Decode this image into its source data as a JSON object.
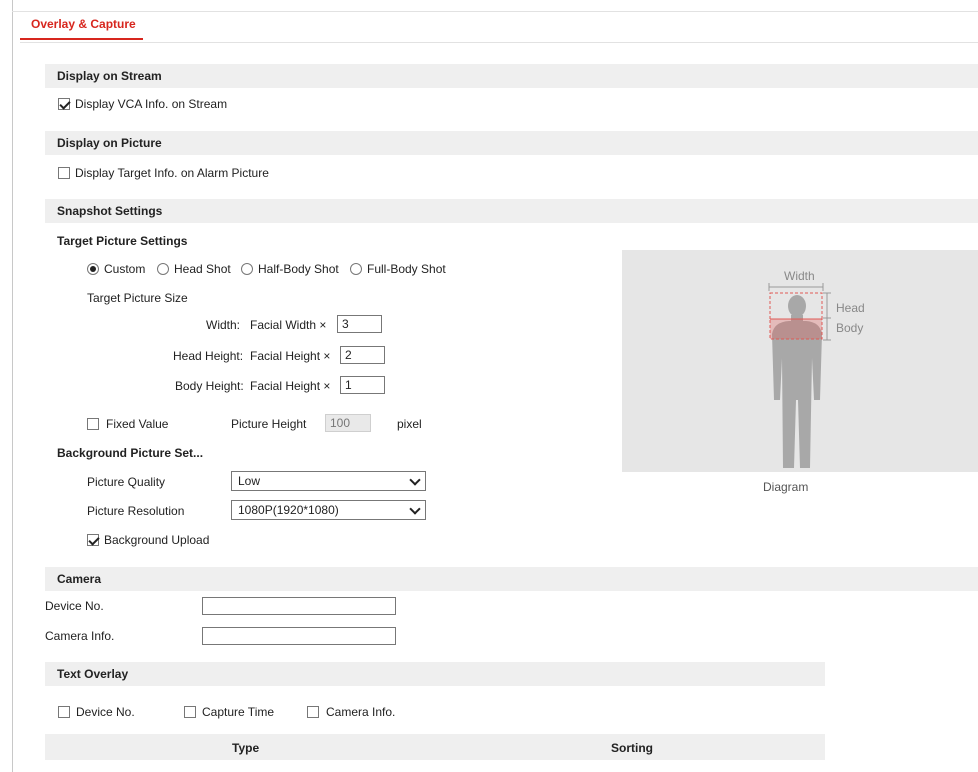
{
  "tabs": [
    {
      "label": "Overlay & Capture"
    }
  ],
  "display_on_stream": {
    "title": "Display on Stream",
    "vca_checkbox": {
      "label": "Display VCA Info. on Stream",
      "checked": true
    }
  },
  "display_on_picture": {
    "title": "Display on Picture",
    "target_checkbox": {
      "label": "Display Target Info. on Alarm Picture",
      "checked": false
    }
  },
  "snapshot": {
    "title": "Snapshot Settings",
    "target_picture": {
      "title": "Target Picture Settings",
      "modes": [
        {
          "label": "Custom",
          "selected": true
        },
        {
          "label": "Head Shot",
          "selected": false
        },
        {
          "label": "Half-Body Shot",
          "selected": false
        },
        {
          "label": "Full-Body Shot",
          "selected": false
        }
      ],
      "size_title": "Target Picture Size",
      "width": {
        "label": "Width:",
        "expr": "Facial Width ×",
        "value": "3"
      },
      "head_height": {
        "label": "Head Height:",
        "expr": "Facial Height ×",
        "value": "2"
      },
      "body_height": {
        "label": "Body Height:",
        "expr": "Facial Height ×",
        "value": "1"
      },
      "fixed_value": {
        "label": "Fixed Value",
        "checked": false
      },
      "picture_height": {
        "label": "Picture Height",
        "value": "100",
        "unit": "pixel"
      }
    },
    "background": {
      "title": "Background Picture Set...",
      "quality": {
        "label": "Picture Quality",
        "value": "Low"
      },
      "resolution": {
        "label": "Picture Resolution",
        "value": "1080P(1920*1080)"
      },
      "upload": {
        "label": "Background Upload",
        "checked": true
      }
    },
    "diagram": {
      "caption": "Diagram",
      "width_label": "Width",
      "head_label": "Head",
      "body_label": "Body"
    }
  },
  "camera": {
    "title": "Camera",
    "device_no": {
      "label": "Device No.",
      "value": ""
    },
    "camera_info": {
      "label": "Camera Info.",
      "value": ""
    }
  },
  "text_overlay": {
    "title": "Text Overlay",
    "options": [
      {
        "label": "Device No.",
        "checked": false
      },
      {
        "label": "Capture Time",
        "checked": false
      },
      {
        "label": "Camera Info.",
        "checked": false
      }
    ],
    "columns": [
      "Type",
      "Sorting"
    ]
  },
  "colors": {
    "accent": "#d7261e",
    "section_bg": "#efefef",
    "diagram_bg": "#e6e6e6"
  }
}
